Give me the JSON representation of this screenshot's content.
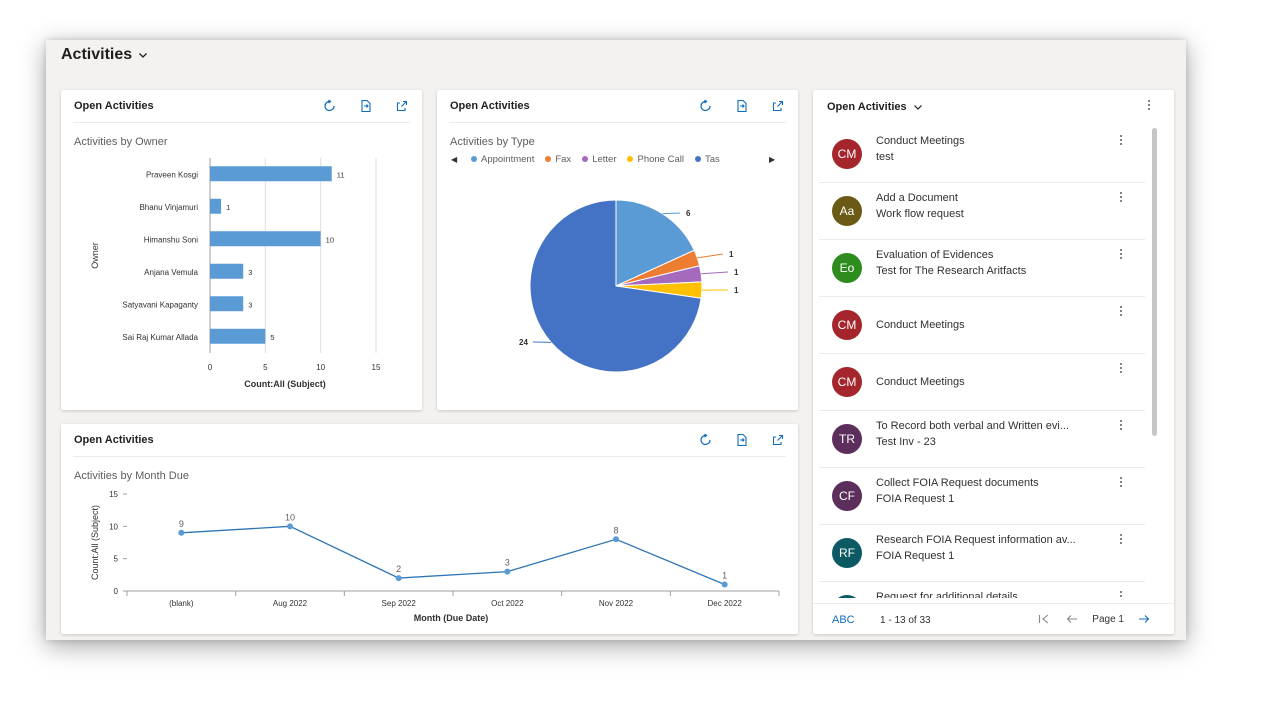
{
  "page": {
    "title": "Activities"
  },
  "cards": {
    "owner": {
      "title": "Open Activities",
      "chart_title": "Activities by Owner"
    },
    "type": {
      "title": "Open Activities",
      "chart_title": "Activities by Type"
    },
    "month": {
      "title": "Open Activities",
      "chart_title": "Activities by Month Due"
    }
  },
  "chart_data": [
    {
      "type": "bar",
      "orientation": "horizontal",
      "title": "Activities by Owner",
      "categories": [
        "Praveen Kosgi",
        "Bhanu Vinjamuri",
        "Himanshu Soni",
        "Anjana Vemula",
        "Satyavani Kapaganty",
        "Sai Raj Kumar Allada"
      ],
      "values": [
        11,
        1,
        10,
        3,
        3,
        5
      ],
      "xlabel": "Count:All (Subject)",
      "ylabel": "Owner",
      "xlim": [
        0,
        15
      ],
      "xticks": [
        "0",
        "5",
        "10",
        "15"
      ],
      "color": "#5b9bd5",
      "grid": true
    },
    {
      "type": "pie",
      "title": "Activities by Type",
      "labels": [
        "Appointment",
        "Fax",
        "Letter",
        "Phone Call",
        "Task"
      ],
      "legend_visible_labels": [
        "Appointment",
        "Fax",
        "Letter",
        "Phone Call",
        "Tas"
      ],
      "values": [
        6,
        1,
        1,
        1,
        24
      ],
      "colors": [
        "#5b9bd5",
        "#ed7d31",
        "#a569bd",
        "#ffc000",
        "#4472c4"
      ],
      "legend": "top"
    },
    {
      "type": "line",
      "title": "Activities by Month Due",
      "categories": [
        "(blank)",
        "Aug 2022",
        "Sep 2022",
        "Oct 2022",
        "Nov 2022",
        "Dec 2022"
      ],
      "values": [
        9,
        10,
        2,
        3,
        8,
        1
      ],
      "xlabel": "Month (Due Date)",
      "ylabel": "Count:All (Subject)",
      "ylim": [
        0,
        15
      ],
      "yticks": [
        "0",
        "5",
        "10",
        "15"
      ],
      "color": "#2e75b6",
      "grid": true
    }
  ],
  "list": {
    "title": "Open Activities",
    "rows": [
      {
        "initials": "CM",
        "color": "#a4262c",
        "title": "Conduct Meetings",
        "subtitle": "test"
      },
      {
        "initials": "Aa",
        "color": "#6b5a16",
        "title": "Add a Document",
        "subtitle": "Work flow request"
      },
      {
        "initials": "Eo",
        "color": "#2e8b1e",
        "title": "Evaluation of Evidences",
        "subtitle": "Test for The Research Aritfacts"
      },
      {
        "initials": "CM",
        "color": "#a4262c",
        "title": "Conduct Meetings",
        "subtitle": ""
      },
      {
        "initials": "CM",
        "color": "#a4262c",
        "title": "Conduct Meetings",
        "subtitle": ""
      },
      {
        "initials": "TR",
        "color": "#5c2e5c",
        "title": "To Record both verbal and Written evi...",
        "subtitle": "Test Inv - 23"
      },
      {
        "initials": "CF",
        "color": "#5c2e5c",
        "title": "Collect FOIA Request documents",
        "subtitle": "FOIA Request 1"
      },
      {
        "initials": "RF",
        "color": "#0b5a63",
        "title": "Research FOIA Request information av...",
        "subtitle": "FOIA Request 1"
      },
      {
        "initials": "Rf",
        "color": "#0b5a63",
        "title": "Request for additional details",
        "subtitle": ""
      }
    ],
    "footer": {
      "abc": "ABC",
      "range": "1 - 13 of 33",
      "page": "Page 1"
    }
  },
  "icons": {
    "refresh": "refresh-icon",
    "export": "export-icon",
    "expand": "expand-icon",
    "more": "more-vertical-icon"
  }
}
